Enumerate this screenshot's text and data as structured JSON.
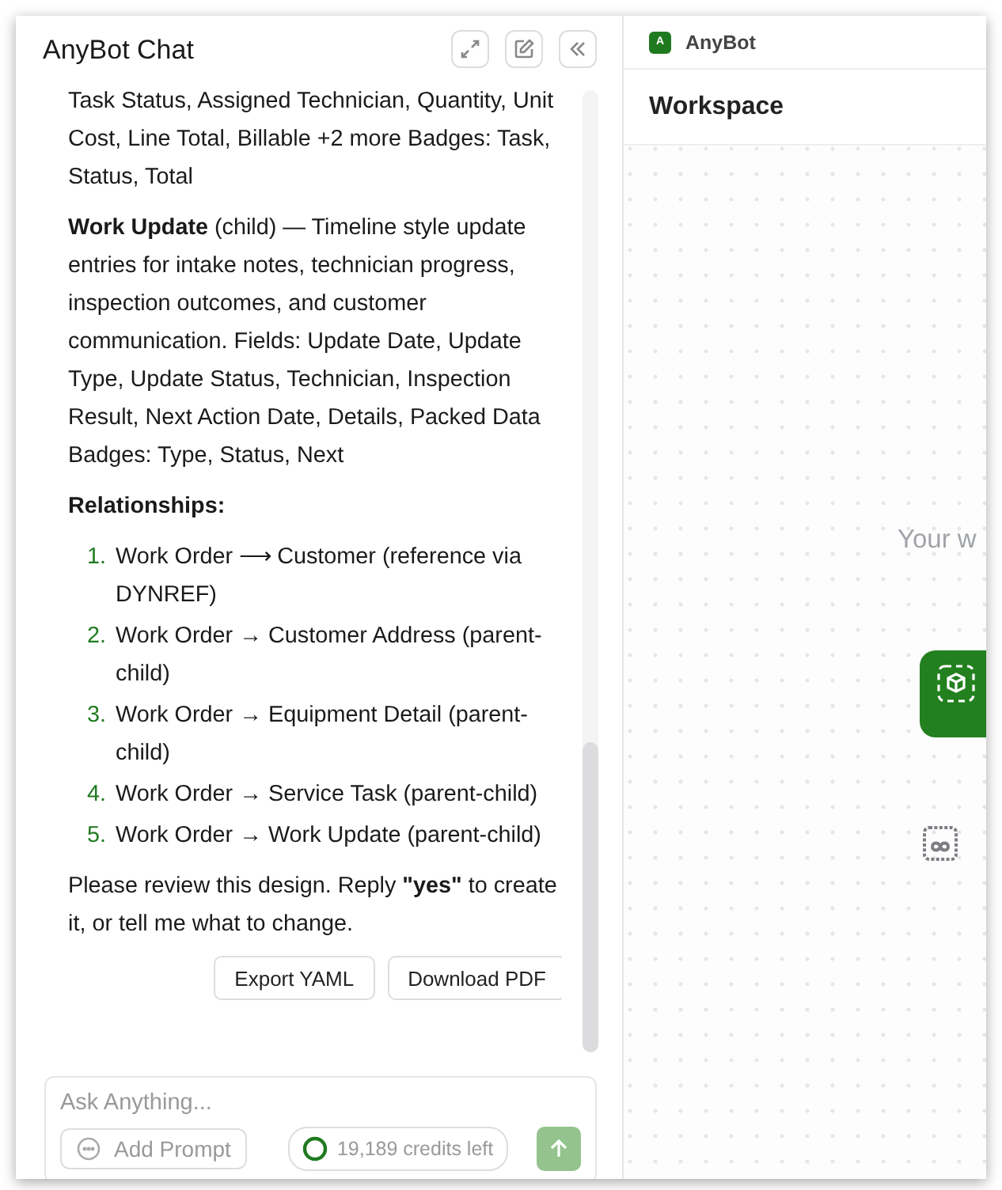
{
  "chat": {
    "title": "AnyBot Chat",
    "message": [
      {
        "kind": "paragraph",
        "text": "Task Status, Assigned Technician, Quantity, Unit Cost, Line Total, Billable +2 more Badges: Task, Status, Total"
      },
      {
        "kind": "paragraph",
        "text": "**Work Update** (child) — Timeline style update entries for intake notes, technician progress, inspection outcomes, and customer communication. Fields: Update Date, Update Type, Update Status, Technician, Inspection Result, Next Action Date, Details, Packed Data Badges: Type, Status, Next"
      },
      {
        "kind": "heading",
        "text": "Relationships:"
      },
      {
        "kind": "list",
        "items": [
          {
            "number": "1.",
            "text": "Work Order ⟶ Customer (reference via DYNREF)"
          },
          {
            "number": "2.",
            "text": "Work Order → Customer Address (parent-child)"
          },
          {
            "number": "3.",
            "text": "Work Order → Equipment Detail (parent-child)"
          },
          {
            "number": "4.",
            "text": "Work Order → Service Task (parent-child)"
          },
          {
            "number": "5.",
            "text": "Work Order → Work Update (parent-child)"
          }
        ]
      },
      {
        "kind": "paragraph",
        "text": "Please review this design. Reply **\"yes\"** to create it, or tell me what to change."
      }
    ],
    "actions": [
      "Export YAML",
      "Download PDF"
    ],
    "input": {
      "placeholder": "Ask Anything..."
    },
    "add_prompt": "Add Prompt",
    "credits": "19,189 credits left",
    "send": {
      "disabled": true
    }
  },
  "workspace": {
    "brand": {
      "logo": "A",
      "name": "AnyBot"
    },
    "title": "Workspace",
    "canvas_text": "Your w"
  }
}
